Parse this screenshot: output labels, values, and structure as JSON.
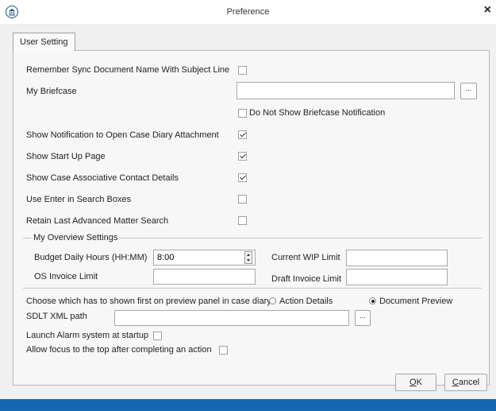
{
  "window": {
    "title": "Preference",
    "close_glyph": "×",
    "app_icon": "building-icon"
  },
  "tab": {
    "label": "User Setting"
  },
  "settings": {
    "remember_sync": {
      "label": "Remember Sync Document Name With Subject Line",
      "checked": false
    },
    "my_briefcase": {
      "label": "My Briefcase",
      "value": "",
      "browse_label": "..."
    },
    "no_briefcase_notification": {
      "label": "Do Not Show Briefcase Notification",
      "checked": false
    },
    "show_notification": {
      "label": "Show Notification to Open Case Diary Attachment",
      "checked": true
    },
    "show_startup": {
      "label": "Show Start Up Page",
      "checked": true
    },
    "show_case_contact": {
      "label": "Show Case Associative Contact Details",
      "checked": true
    },
    "use_enter": {
      "label": "Use Enter in Search Boxes",
      "checked": false
    },
    "retain_search": {
      "label": "Retain Last Advanced Matter Search",
      "checked": false
    }
  },
  "overview": {
    "legend": "My Overview Settings",
    "budget_label": "Budget Daily Hours (HH:MM)",
    "budget_value": "8:00",
    "wip_label": "Current WIP Limit",
    "wip_value": "",
    "os_invoice_label": "OS Invoice Limit",
    "os_invoice_value": "",
    "draft_invoice_label": "Draft Invoice Limit",
    "draft_invoice_value": ""
  },
  "preview": {
    "label": "Choose which has to shown first on preview panel in case diary",
    "option_action": "Action Details",
    "option_document": "Document Preview",
    "selected": "Document Preview"
  },
  "sdlt": {
    "label": "SDLT XML path",
    "value": "",
    "browse_label": "..."
  },
  "alarm": {
    "label": "Launch Alarm system at startup",
    "checked": false
  },
  "focus_top": {
    "label": "Allow focus to the top after completing an action",
    "checked": false
  },
  "buttons": {
    "ok_mnemonic": "O",
    "ok_rest": "K",
    "cancel_mnemonic": "C",
    "cancel_rest": "ancel"
  },
  "colors": {
    "accent": "#1666b0",
    "background": "#f0f0f0"
  }
}
